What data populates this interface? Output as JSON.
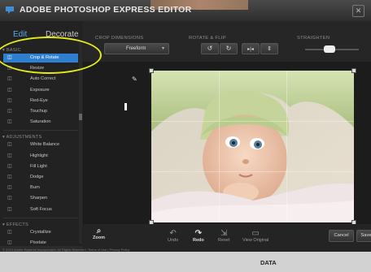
{
  "app": {
    "title": "ADOBE PHOTOSHOP EXPRESS EDITOR",
    "close_symbol": "✕"
  },
  "sidebar": {
    "tabs": {
      "edit": "Edit",
      "decorate": "Decorate"
    },
    "sections": [
      {
        "title": "BASIC",
        "items": [
          {
            "label": "Crop & Rotate",
            "icon": "crop-icon",
            "selected": true
          },
          {
            "label": "Resize",
            "icon": "resize-icon"
          },
          {
            "label": "Auto Correct",
            "icon": "wand-icon"
          },
          {
            "label": "Exposure",
            "icon": "exposure-icon"
          },
          {
            "label": "Red-Eye",
            "icon": "eye-icon"
          },
          {
            "label": "Touchup",
            "icon": "touchup-icon"
          },
          {
            "label": "Saturation",
            "icon": "saturation-icon"
          }
        ]
      },
      {
        "title": "ADJUSTMENTS",
        "items": [
          {
            "label": "White Balance",
            "icon": "white-balance-icon"
          },
          {
            "label": "Highlight",
            "icon": "highlight-icon"
          },
          {
            "label": "Fill Light",
            "icon": "fill-light-icon"
          },
          {
            "label": "Dodge",
            "icon": "dodge-icon"
          },
          {
            "label": "Burn",
            "icon": "burn-icon"
          },
          {
            "label": "Sharpen",
            "icon": "sharpen-icon"
          },
          {
            "label": "Soft Focus",
            "icon": "soft-focus-icon"
          }
        ]
      },
      {
        "title": "EFFECTS",
        "items": [
          {
            "label": "Crystallize",
            "icon": "crystallize-icon"
          },
          {
            "label": "Pixelate",
            "icon": "pixelate-icon"
          }
        ]
      }
    ],
    "footer": "© 2010 Adobe Systems Incorporated. All Rights Reserved.   Terms of Use  |  Privacy Policy"
  },
  "toolbar": {
    "crop_dimensions_label": "CROP DIMENSIONS",
    "crop_dimension_value": "Freeform",
    "rotate_flip_label": "ROTATE & FLIP",
    "straighten_label": "STRAIGHTEN",
    "straighten_level": 0.45
  },
  "bottom": {
    "zoom": "Zoom",
    "undo": "Undo",
    "redo": "Redo",
    "reset": "Reset",
    "view_original": "View Original",
    "cancel": "Cancel",
    "save": "Save"
  },
  "below_page": {
    "text": "DATA"
  },
  "colors": {
    "accent": "#2f7fd1",
    "highlight_ring": "#e3ec18"
  }
}
